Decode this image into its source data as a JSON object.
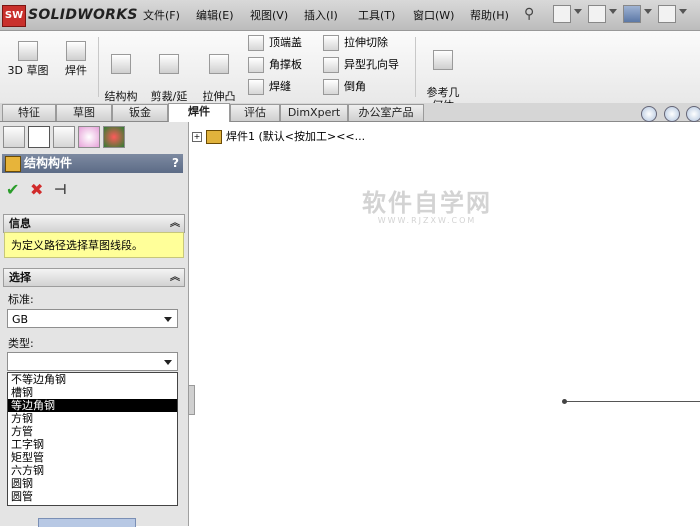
{
  "app": {
    "logo_text": "SOLIDWORKS",
    "logo_mark": "SW"
  },
  "menubar": [
    "文件(F)",
    "编辑(E)",
    "视图(V)",
    "插入(I)",
    "工具(T)",
    "窗口(W)",
    "帮助(H)"
  ],
  "ribbon": {
    "large_buttons": [
      "3D 草图",
      "焊件",
      "结构构\n件",
      "剪裁/延\n伸",
      "拉伸凸\n台/基体"
    ],
    "small_col1": [
      "顶端盖",
      "角撑板",
      "焊缝"
    ],
    "small_col2": [
      "拉伸切除",
      "异型孔向导",
      "倒角"
    ],
    "ref_geometry": "参考几\n何体"
  },
  "tabs": [
    "特征",
    "草图",
    "钣金",
    "焊件",
    "评估",
    "DimXpert",
    "办公室产品"
  ],
  "active_tab": "焊件",
  "property_manager": {
    "title": "结构构件",
    "help": "?",
    "info": {
      "header": "信息",
      "message": "为定义路径选择草图线段。"
    },
    "selection": {
      "header": "选择",
      "standard_label": "标准:",
      "standard_value": "GB",
      "type_label": "类型:",
      "type_value": "",
      "type_options": [
        "不等边角钢",
        "槽钢",
        "等边角钢",
        "方钢",
        "方管",
        "工字钢",
        "矩型管",
        "六方钢",
        "圆钢",
        "圆管"
      ],
      "selected_option": "等边角钢"
    }
  },
  "tree": {
    "root": "焊件1 (默认<按加工><<..."
  },
  "watermark": {
    "big": "软件自学网",
    "small": "WWW.RJZXW.COM"
  },
  "colors": {
    "title_bg": "#5c6b86",
    "info_bg": "#ffff99",
    "selected_option_bg": "#000000"
  }
}
